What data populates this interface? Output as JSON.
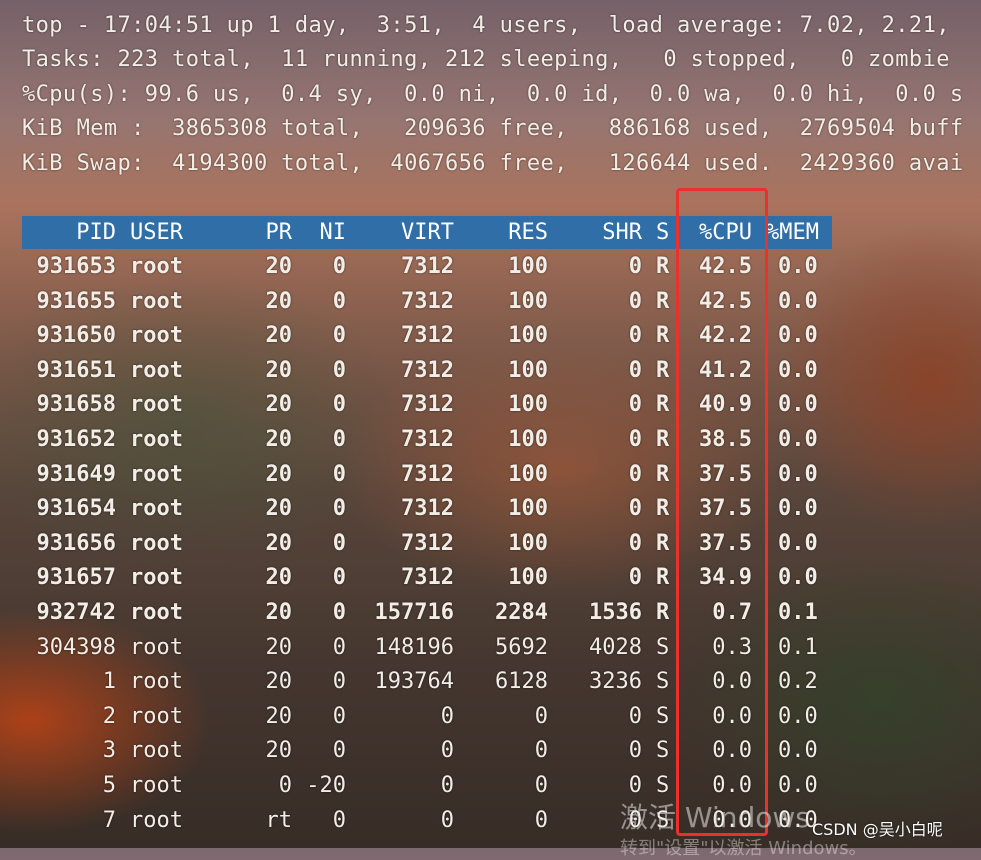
{
  "summary": {
    "line1": "top - 17:04:51 up 1 day,  3:51,  4 users,  load average: 7.02, 2.21,",
    "line2": "Tasks: 223 total,  11 running, 212 sleeping,   0 stopped,   0 zombie",
    "line3": "%Cpu(s): 99.6 us,  0.4 sy,  0.0 ni,  0.0 id,  0.0 wa,  0.0 hi,  0.0 s",
    "line4": "KiB Mem :  3865308 total,   209636 free,   886168 used,  2769504 buff",
    "line5": "KiB Swap:  4194300 total,  4067656 free,   126644 used.  2429360 avai"
  },
  "columns": {
    "pid": "PID",
    "user": "USER",
    "pr": "PR",
    "ni": "NI",
    "virt": "VIRT",
    "res": "RES",
    "shr": "SHR",
    "s": "S",
    "cpu": "%CPU",
    "mem": "%MEM"
  },
  "processes": [
    {
      "pid": "931653",
      "user": "root",
      "pr": "20",
      "ni": "0",
      "virt": "7312",
      "res": "100",
      "shr": "0",
      "s": "R",
      "cpu": "42.5",
      "mem": "0.0",
      "bold": true
    },
    {
      "pid": "931655",
      "user": "root",
      "pr": "20",
      "ni": "0",
      "virt": "7312",
      "res": "100",
      "shr": "0",
      "s": "R",
      "cpu": "42.5",
      "mem": "0.0",
      "bold": true
    },
    {
      "pid": "931650",
      "user": "root",
      "pr": "20",
      "ni": "0",
      "virt": "7312",
      "res": "100",
      "shr": "0",
      "s": "R",
      "cpu": "42.2",
      "mem": "0.0",
      "bold": true
    },
    {
      "pid": "931651",
      "user": "root",
      "pr": "20",
      "ni": "0",
      "virt": "7312",
      "res": "100",
      "shr": "0",
      "s": "R",
      "cpu": "41.2",
      "mem": "0.0",
      "bold": true
    },
    {
      "pid": "931658",
      "user": "root",
      "pr": "20",
      "ni": "0",
      "virt": "7312",
      "res": "100",
      "shr": "0",
      "s": "R",
      "cpu": "40.9",
      "mem": "0.0",
      "bold": true
    },
    {
      "pid": "931652",
      "user": "root",
      "pr": "20",
      "ni": "0",
      "virt": "7312",
      "res": "100",
      "shr": "0",
      "s": "R",
      "cpu": "38.5",
      "mem": "0.0",
      "bold": true
    },
    {
      "pid": "931649",
      "user": "root",
      "pr": "20",
      "ni": "0",
      "virt": "7312",
      "res": "100",
      "shr": "0",
      "s": "R",
      "cpu": "37.5",
      "mem": "0.0",
      "bold": true
    },
    {
      "pid": "931654",
      "user": "root",
      "pr": "20",
      "ni": "0",
      "virt": "7312",
      "res": "100",
      "shr": "0",
      "s": "R",
      "cpu": "37.5",
      "mem": "0.0",
      "bold": true
    },
    {
      "pid": "931656",
      "user": "root",
      "pr": "20",
      "ni": "0",
      "virt": "7312",
      "res": "100",
      "shr": "0",
      "s": "R",
      "cpu": "37.5",
      "mem": "0.0",
      "bold": true
    },
    {
      "pid": "931657",
      "user": "root",
      "pr": "20",
      "ni": "0",
      "virt": "7312",
      "res": "100",
      "shr": "0",
      "s": "R",
      "cpu": "34.9",
      "mem": "0.0",
      "bold": true
    },
    {
      "pid": "932742",
      "user": "root",
      "pr": "20",
      "ni": "0",
      "virt": "157716",
      "res": "2284",
      "shr": "1536",
      "s": "R",
      "cpu": "0.7",
      "mem": "0.1",
      "bold": true
    },
    {
      "pid": "304398",
      "user": "root",
      "pr": "20",
      "ni": "0",
      "virt": "148196",
      "res": "5692",
      "shr": "4028",
      "s": "S",
      "cpu": "0.3",
      "mem": "0.1",
      "bold": false
    },
    {
      "pid": "1",
      "user": "root",
      "pr": "20",
      "ni": "0",
      "virt": "193764",
      "res": "6128",
      "shr": "3236",
      "s": "S",
      "cpu": "0.0",
      "mem": "0.2",
      "bold": false
    },
    {
      "pid": "2",
      "user": "root",
      "pr": "20",
      "ni": "0",
      "virt": "0",
      "res": "0",
      "shr": "0",
      "s": "S",
      "cpu": "0.0",
      "mem": "0.0",
      "bold": false
    },
    {
      "pid": "3",
      "user": "root",
      "pr": "20",
      "ni": "0",
      "virt": "0",
      "res": "0",
      "shr": "0",
      "s": "S",
      "cpu": "0.0",
      "mem": "0.0",
      "bold": false
    },
    {
      "pid": "5",
      "user": "root",
      "pr": "0",
      "ni": "-20",
      "virt": "0",
      "res": "0",
      "shr": "0",
      "s": "S",
      "cpu": "0.0",
      "mem": "0.0",
      "bold": false
    },
    {
      "pid": "7",
      "user": "root",
      "pr": "rt",
      "ni": "0",
      "virt": "0",
      "res": "0",
      "shr": "0",
      "s": "S",
      "cpu": "0.0",
      "mem": "0.0",
      "bold": false
    }
  ],
  "overlay": {
    "activate_title": "激活 Windows",
    "activate_sub": "转到\"设置\"以激活 Windows。",
    "watermark": "CSDN @吴小白呢"
  },
  "colors": {
    "header_bar": "#2f6ea6",
    "highlight_box": "#e8322b",
    "text": "#f2ede6"
  }
}
